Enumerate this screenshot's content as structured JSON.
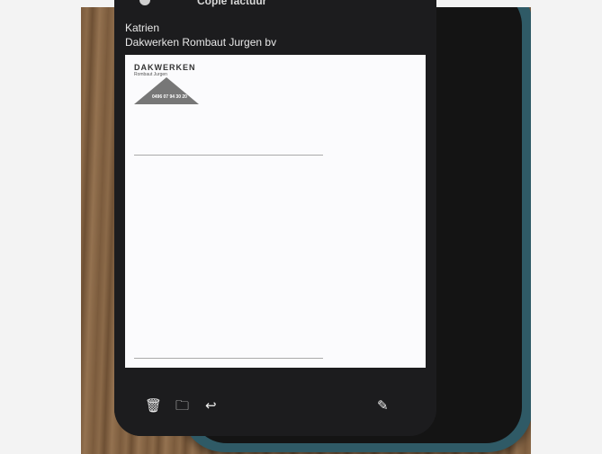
{
  "email": {
    "title": "Copie factuur",
    "sender": "Katrien",
    "subject": "Dakwerken Rombaut Jurgen bv"
  },
  "document": {
    "brand": "DAKWERKEN",
    "brand_sub": "Rombaut Jurgen",
    "phone": "0496 07 94 30 20"
  },
  "toolbar": {
    "icons": [
      "trash-icon",
      "folder-icon",
      "reply-icon",
      "compose-icon"
    ]
  }
}
